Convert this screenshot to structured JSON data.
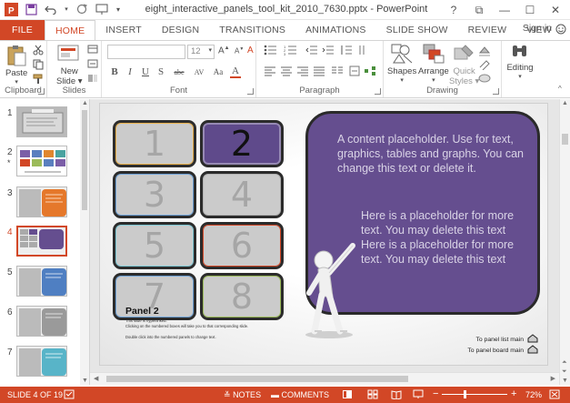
{
  "window": {
    "title": "eight_interactive_panels_tool_kit_2010_7630.pptx - PowerPoint",
    "controls": [
      "?",
      "⧉",
      "—",
      "☐",
      "✕"
    ]
  },
  "ribbon_tabs": [
    "FILE",
    "HOME",
    "INSERT",
    "DESIGN",
    "TRANSITIONS",
    "ANIMATIONS",
    "SLIDE SHOW",
    "REVIEW",
    "VIEW"
  ],
  "sign_in": "Sign in",
  "ribbon": {
    "clipboard": {
      "label": "Clipboard",
      "paste": "Paste"
    },
    "slides": {
      "label": "Slides",
      "new_slide_line1": "New",
      "new_slide_line2": "Slide"
    },
    "font": {
      "label": "Font",
      "size": "12",
      "buttons": [
        "B",
        "I",
        "U",
        "S",
        "abc",
        "AV",
        "Aa",
        "A"
      ]
    },
    "paragraph": {
      "label": "Paragraph"
    },
    "drawing": {
      "label": "Drawing",
      "shapes": "Shapes",
      "arrange": "Arrange",
      "quick_styles_line1": "Quick",
      "quick_styles_line2": "Styles"
    },
    "editing": {
      "label": "Editing"
    }
  },
  "thumbnails": [
    {
      "num": "1",
      "star": ""
    },
    {
      "num": "2",
      "star": "*"
    },
    {
      "num": "3",
      "star": ""
    },
    {
      "num": "4",
      "star": "",
      "active": true
    },
    {
      "num": "5",
      "star": ""
    },
    {
      "num": "6",
      "star": ""
    },
    {
      "num": "7",
      "star": ""
    }
  ],
  "slide": {
    "panels": [
      "1",
      "2",
      "3",
      "4",
      "5",
      "6",
      "7",
      "8"
    ],
    "selected_panel": "2",
    "content_text_1": "A content placeholder.  Use for text, graphics, tables and graphs.  You can change this text or delete it.",
    "content_text_2": "Here is a placeholder for more text.  You may delete this text\nHere is a placeholder for more text.  You may delete this text",
    "panel_title": "Panel 2",
    "note_1": "This slide is hyperlinked.",
    "note_2": "Clicking on the numbered boxes will take you to that corresponding slide.",
    "note_3": "Double click into the numbered panels to change text.",
    "nav_list": "To panel list main",
    "nav_board": "To panel board main"
  },
  "status": {
    "slide_info": "SLIDE 4 OF 19",
    "notes": "NOTES",
    "comments": "COMMENTS",
    "zoom": "72%"
  },
  "colors": {
    "accent": "#d24726",
    "content_box": "#654e8f",
    "selected_panel": "#5f4a8b"
  }
}
